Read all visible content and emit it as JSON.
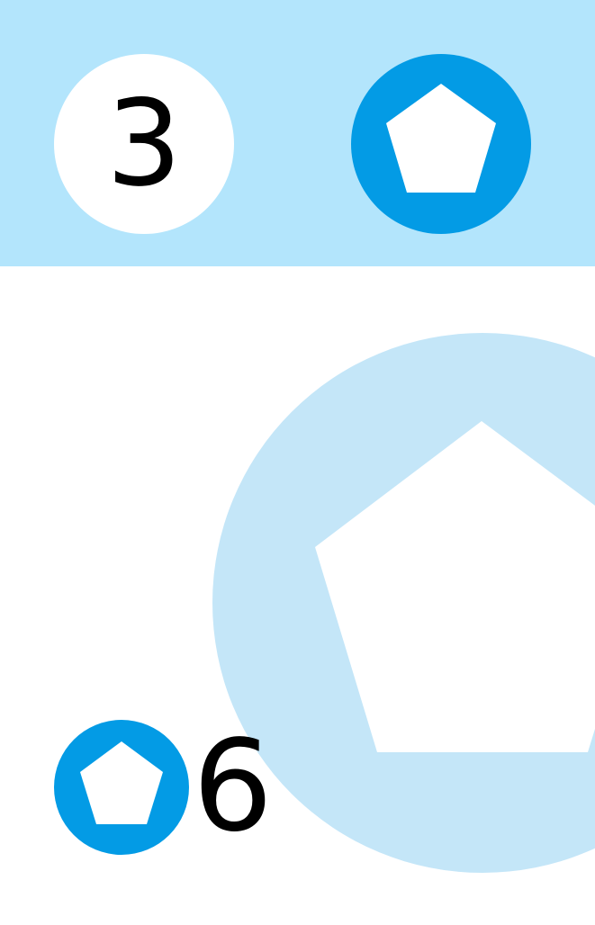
{
  "header": {
    "number_badge": "3",
    "shape_icon": "pentagon-icon"
  },
  "main": {
    "background_icon": "pentagon-icon"
  },
  "footer": {
    "shape_icon": "pentagon-icon",
    "count": "6"
  },
  "colors": {
    "header_background": "#b3e5fc",
    "primary_blue": "#039be5",
    "light_circle": "#c4e6f8",
    "text": "#000000",
    "background": "#ffffff"
  }
}
